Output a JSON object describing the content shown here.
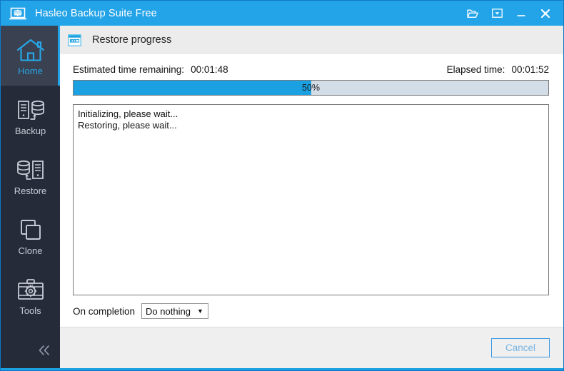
{
  "window": {
    "title": "Hasleo Backup Suite Free",
    "icon": "laptop-transfer-icon",
    "accent_color": "#23a3e8",
    "controls": [
      {
        "name": "folder-open-icon",
        "label": "Open"
      },
      {
        "name": "dropdown-box-icon",
        "label": "Menu"
      },
      {
        "name": "minimize-icon",
        "label": "Minimize"
      },
      {
        "name": "close-icon",
        "label": "Close"
      }
    ]
  },
  "sidebar": {
    "background_color": "#252b38",
    "active_color": "#28a8e8",
    "items": [
      {
        "label": "Home",
        "icon": "home-icon",
        "active": true
      },
      {
        "label": "Backup",
        "icon": "backup-icon",
        "active": false
      },
      {
        "label": "Restore",
        "icon": "restore-icon",
        "active": false
      },
      {
        "label": "Clone",
        "icon": "clone-icon",
        "active": false
      },
      {
        "label": "Tools",
        "icon": "tools-icon",
        "active": false
      }
    ],
    "collapse": {
      "icon": "chevron-double-left-icon",
      "label": "Collapse"
    }
  },
  "page": {
    "icon": "progress-window-icon",
    "title": "Restore progress"
  },
  "status": {
    "estimated_label": "Estimated time remaining:",
    "estimated_value": "00:01:48",
    "elapsed_label": "Elapsed time:",
    "elapsed_value": "00:01:52"
  },
  "progress": {
    "percent": 50,
    "percent_text": "50%",
    "fill_color": "#1ba1e2",
    "track_color": "#d3dde7"
  },
  "log": {
    "lines": [
      "Initializing, please wait...",
      "Restoring, please wait..."
    ]
  },
  "completion": {
    "label": "On completion",
    "selected": "Do nothing",
    "caret": "▼"
  },
  "footer": {
    "cancel_label": "Cancel"
  }
}
